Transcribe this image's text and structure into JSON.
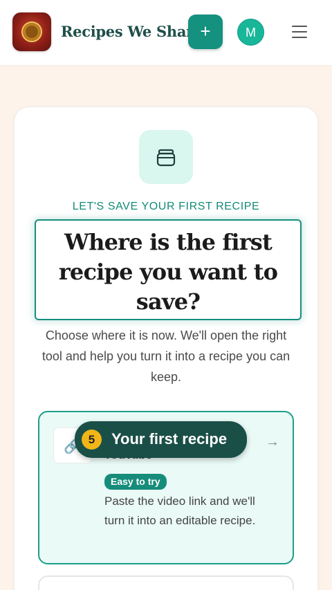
{
  "header": {
    "brand": "Recipes We Share",
    "add_label": "+",
    "avatar_initial": "M",
    "logo_icon": "tree-seal-logo",
    "menu_icon": "hamburger-icon"
  },
  "hero": {
    "icon": "jar-icon",
    "eyebrow": "LET'S SAVE YOUR FIRST RECIPE",
    "headline": "Where is the first recipe you want to save?",
    "subtitle": "Choose where it is now. We'll open the right tool and help you turn it into a recipe you can keep."
  },
  "options": [
    {
      "icon": "link-icon",
      "title": "YouTube",
      "badge": "Easy to try",
      "description": "Paste the video link and we'll turn it into an editable recipe.",
      "arrow_icon": "arrow-right-icon"
    }
  ],
  "tooltip": {
    "step": "5",
    "text": "Your first recipe"
  },
  "colors": {
    "accent": "#14917f",
    "brand_text": "#1f4f4a",
    "tooltip_bg": "#1a4f47",
    "step_badge": "#f2b518",
    "page_bg": "#fdf3ea"
  }
}
